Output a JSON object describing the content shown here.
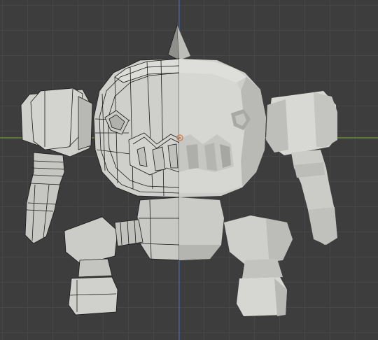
{
  "viewport": {
    "mode": "3D Viewport",
    "object": "robot-mesh",
    "half_display": [
      "wireframe-overlay",
      "solid"
    ]
  },
  "colors": {
    "background": "#3d3d3d",
    "grid": "#464646",
    "axis_x": "#7a9a3a",
    "axis_z": "#4a6aa8",
    "mesh_light": "#d6d6d2",
    "mesh_mid": "#bdbdb8",
    "mesh_dark": "#8e8e8a",
    "wire": "#1a1a1a",
    "origin": "#c8865c"
  }
}
